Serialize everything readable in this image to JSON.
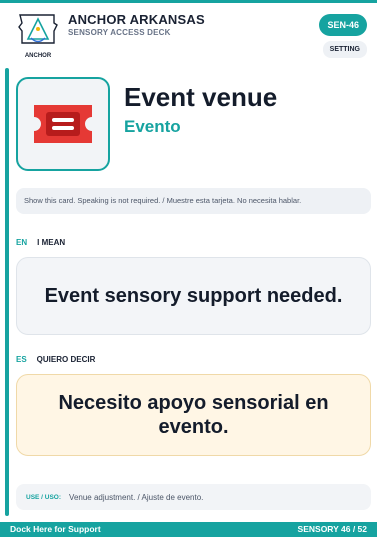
{
  "brand": {
    "logo_text": "ANCHOR",
    "name": "ANCHOR ARKANSAS",
    "subtitle": "SENSORY ACCESS DECK"
  },
  "card": {
    "code": "SEN-46",
    "category": "SETTING",
    "title_en": "Event venue",
    "title_es": "Evento",
    "icon": "ticket-icon",
    "notice": "Show this card. Speaking is not required. / Muestre esta tarjeta. No necesita hablar."
  },
  "english": {
    "code": "EN",
    "label": "I MEAN",
    "phrase": "Event sensory support needed."
  },
  "spanish": {
    "code": "ES",
    "label": "QUIERO DECIR",
    "phrase": "Necesito apoyo sensorial en evento."
  },
  "usage": {
    "label": "USE / USO:",
    "text": "Venue adjustment. / Ajuste de evento."
  },
  "footer": {
    "left": "Dock Here for Support",
    "right": "SENSORY 46 / 52"
  },
  "colors": {
    "accent": "#16a3a0",
    "ticket": "#e53935",
    "spanish_box": "#fff6e5"
  }
}
